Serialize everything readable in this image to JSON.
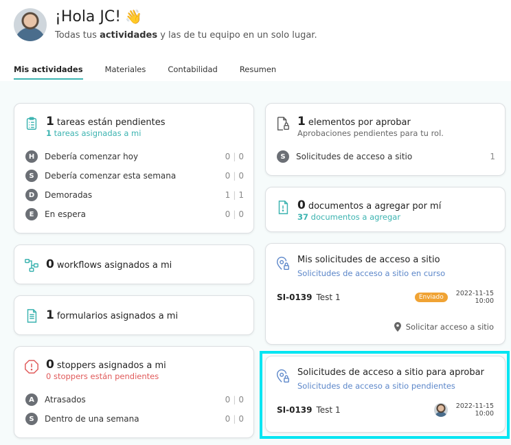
{
  "header": {
    "greeting": "¡Hola JC!",
    "wave": "👋",
    "subtitle_pre": "Todas tus ",
    "subtitle_bold": "actividades",
    "subtitle_post": " y las de tu equipo en un solo lugar."
  },
  "tabs": [
    {
      "label": "Mis actividades",
      "active": true
    },
    {
      "label": "Materiales"
    },
    {
      "label": "Contabilidad"
    },
    {
      "label": "Resumen"
    }
  ],
  "tasks_card": {
    "count": "1",
    "title": "tareas están pendientes",
    "sub_count": "1",
    "sub_text": " tareas asignadas a mi",
    "rows": [
      {
        "badge": "H",
        "label": "Debería comenzar hoy",
        "a": "0",
        "b": "0"
      },
      {
        "badge": "S",
        "label": "Debería comenzar esta semana",
        "a": "0",
        "b": "0"
      },
      {
        "badge": "D",
        "label": "Demoradas",
        "a": "1",
        "b": "1"
      },
      {
        "badge": "E",
        "label": "En espera",
        "a": "0",
        "b": "0"
      }
    ]
  },
  "workflows_card": {
    "count": "0",
    "title": "workflows asignados a mi"
  },
  "forms_card": {
    "count": "1",
    "title": "formularios asignados a mi"
  },
  "stoppers_card": {
    "count": "0",
    "title": "stoppers asignados a mi",
    "sub": "0 stoppers están pendientes",
    "rows": [
      {
        "badge": "A",
        "label": "Atrasados",
        "a": "0",
        "b": "0"
      },
      {
        "badge": "S",
        "label": "Dentro de una semana",
        "a": "0",
        "b": "0"
      }
    ]
  },
  "approvals_card": {
    "count": "1",
    "title": "elementos por aprobar",
    "sub": "Aprobaciones pendientes para tu rol.",
    "row": {
      "badge": "S",
      "label": "Solicitudes de acceso a sitio",
      "value": "1"
    }
  },
  "docs_card": {
    "count": "0",
    "title": "documentos a agregar por mí",
    "sub_count": "37",
    "sub_text": " documentos a agregar"
  },
  "my_requests_card": {
    "title": "Mis solicitudes de acceso a sitio",
    "sub": "Solicitudes de acceso a sitio en curso",
    "item": {
      "id": "SI-0139",
      "name": "Test 1",
      "status": "Enviado",
      "date": "2022-11-15",
      "time": "10:00"
    },
    "link": "Solicitar acceso a sitio"
  },
  "approve_requests_card": {
    "title": "Solicitudes de acceso a sitio para aprobar",
    "sub": "Solicitudes de acceso a sitio pendientes",
    "item": {
      "id": "SI-0139",
      "name": "Test 1",
      "date": "2022-11-15",
      "time": "10:00"
    }
  },
  "colors": {
    "accent": "#3bb3b0",
    "highlight": "#00e5f2",
    "status": "#f0a334",
    "danger": "#e05a5a",
    "link_blue": "#5b86c9"
  }
}
